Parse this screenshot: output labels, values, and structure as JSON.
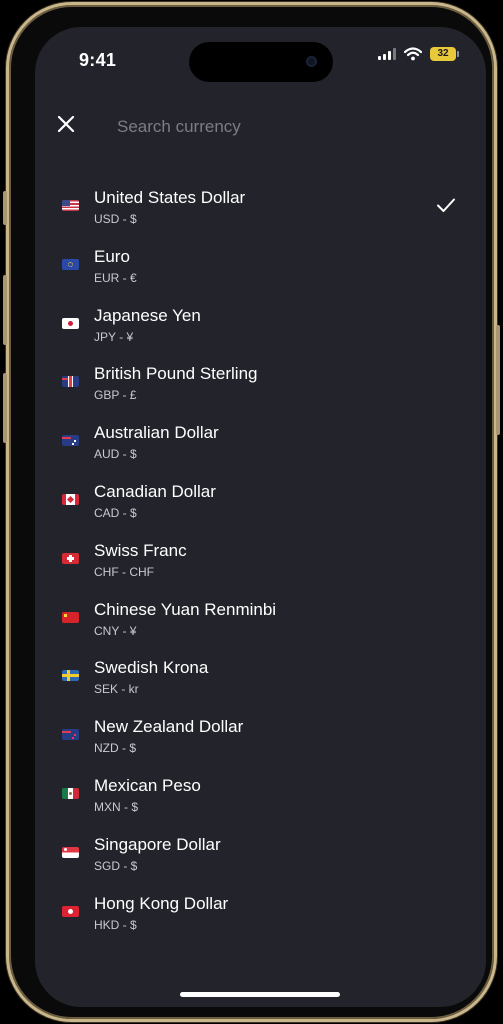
{
  "status_bar": {
    "time": "9:41",
    "battery": "32"
  },
  "header": {
    "search_placeholder": "Search currency"
  },
  "currencies": [
    {
      "name": "United States Dollar",
      "code": "USD - $",
      "flag": "us",
      "selected": true
    },
    {
      "name": "Euro",
      "code": "EUR - €",
      "flag": "eu",
      "selected": false
    },
    {
      "name": "Japanese Yen",
      "code": "JPY - ¥",
      "flag": "jp",
      "selected": false
    },
    {
      "name": "British Pound Sterling",
      "code": "GBP - £",
      "flag": "gb",
      "selected": false
    },
    {
      "name": "Australian Dollar",
      "code": "AUD - $",
      "flag": "au",
      "selected": false
    },
    {
      "name": "Canadian Dollar",
      "code": "CAD - $",
      "flag": "ca",
      "selected": false
    },
    {
      "name": "Swiss Franc",
      "code": "CHF - CHF",
      "flag": "ch",
      "selected": false
    },
    {
      "name": "Chinese Yuan Renminbi",
      "code": "CNY - ¥",
      "flag": "cn",
      "selected": false
    },
    {
      "name": "Swedish Krona",
      "code": "SEK - kr",
      "flag": "se",
      "selected": false
    },
    {
      "name": "New Zealand Dollar",
      "code": "NZD - $",
      "flag": "nz",
      "selected": false
    },
    {
      "name": "Mexican Peso",
      "code": "MXN - $",
      "flag": "mx",
      "selected": false
    },
    {
      "name": "Singapore Dollar",
      "code": "SGD - $",
      "flag": "sg",
      "selected": false
    },
    {
      "name": "Hong Kong Dollar",
      "code": "HKD - $",
      "flag": "hk",
      "selected": false
    }
  ],
  "icons": {
    "close": "close-icon",
    "check": "checkmark-icon",
    "signal": "cellular-signal-icon",
    "wifi": "wifi-icon",
    "battery": "battery-icon"
  },
  "colors": {
    "background": "#23242b",
    "text_primary": "#ffffff",
    "text_secondary": "#c9cad0",
    "placeholder": "#7a7d86",
    "battery_fill": "#e8c93a"
  }
}
